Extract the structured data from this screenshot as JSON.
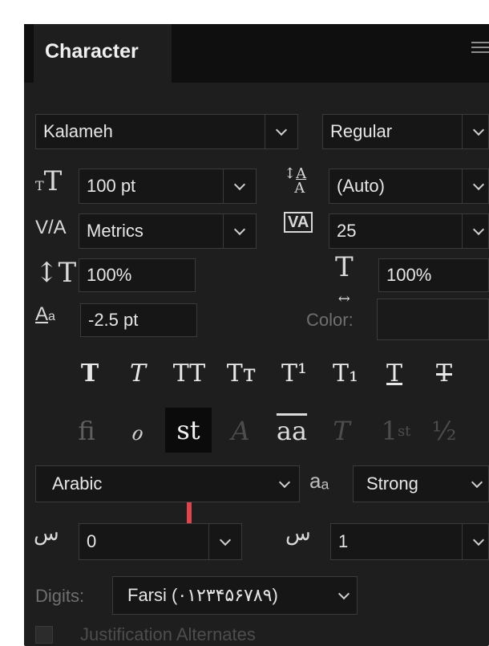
{
  "panel": {
    "title": "Character",
    "menu_icon": "panel-menu-icon"
  },
  "font": {
    "family": "Kalameh",
    "style": "Regular"
  },
  "size": {
    "font_size": "100 pt",
    "leading": "(Auto)"
  },
  "kerning": {
    "kerning": "Metrics",
    "tracking": "25"
  },
  "scale": {
    "vertical": "100%",
    "horizontal": "100%"
  },
  "baseline": {
    "shift": "-2.5 pt",
    "color_label": "Color:"
  },
  "type_styles": [
    "T",
    "T",
    "TT",
    "Tт",
    "T¹",
    "T₁",
    "T",
    "T"
  ],
  "opentype": [
    "ﬁ",
    "ℴ",
    "st",
    "A",
    "aa",
    "T",
    "1st",
    "½"
  ],
  "opentype_extra": {
    "ordinal_number": "1",
    "ordinal_suffix": "st",
    "ligature_a": "aa"
  },
  "language": {
    "value": "Arabic",
    "script_icon": "aₐ",
    "kashida": "Strong"
  },
  "diacritics": {
    "horizontal": "0",
    "vertical": "1"
  },
  "digits": {
    "label": "Digits:",
    "value": "Farsi (۰۱۲۳۴۵۶۷۸۹)"
  },
  "justification": {
    "label": "Justification Alternates"
  },
  "colors": {
    "panel": "#1f1e1e",
    "field": "#161616",
    "arrow": "#e0454d",
    "text": "#e6e6e6"
  }
}
